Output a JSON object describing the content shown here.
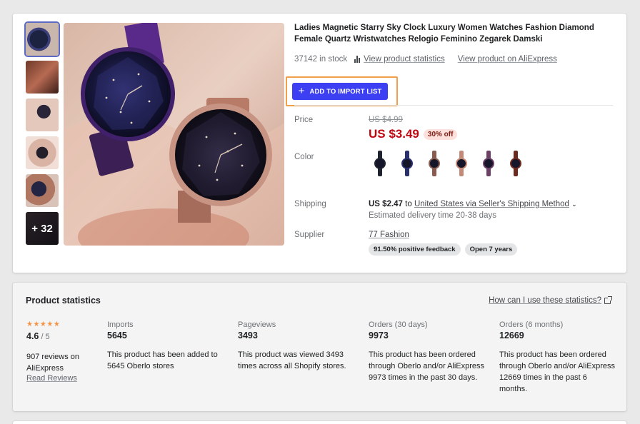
{
  "product": {
    "title": "Ladies Magnetic Starry Sky Clock Luxury Women Watches Fashion Diamond Female Quartz Wristwatches Relogio Feminino Zegarek Damski",
    "stock": "37142 in stock",
    "view_stats_link": "View product statistics",
    "view_aliexpress_link": "View product on AliExpress",
    "add_button": "ADD TO IMPORT LIST",
    "more_images": "+ 32",
    "price_label": "Price",
    "old_price": "US $4.99",
    "price": "US $3.49",
    "discount": "30% off",
    "color_label": "Color",
    "colors": [
      "#1f2330",
      "#2a2f6e",
      "#8a5a4f",
      "#c48a78",
      "#6b3f66",
      "#6b2a1d"
    ],
    "shipping_label": "Shipping",
    "shipping_price": "US $2.47",
    "shipping_to": "to",
    "shipping_method": "United States via Seller's Shipping Method",
    "delivery": "Estimated delivery time 20-38 days",
    "supplier_label": "Supplier",
    "supplier_name": "77 Fashion",
    "feedback": "91.50% positive feedback",
    "open_years": "Open 7 years"
  },
  "stats": {
    "title": "Product statistics",
    "help_link": "How can I use these statistics?",
    "stars": "★★★★★",
    "rating_value": "4.6",
    "rating_max": " / 5",
    "reviews_text": "907 reviews on AliExpress",
    "read_reviews": "Read Reviews",
    "columns": [
      {
        "label": "Imports",
        "value": "5645",
        "desc": "This product has been added to 5645 Oberlo stores"
      },
      {
        "label": "Pageviews",
        "value": "3493",
        "desc": "This product was viewed 3493 times across all Shopify stores."
      },
      {
        "label": "Orders (30 days)",
        "value": "9973",
        "desc": "This product has been ordered through Oberlo and/or AliExpress 9973 times in the past 30 days."
      },
      {
        "label": "Orders (6 months)",
        "value": "12669",
        "desc": "This product has been ordered through Oberlo and/or AliExpress 12669 times in the past 6 months."
      }
    ]
  },
  "colors": {
    "accent": "#3d40f2",
    "highlight": "#f0a04b",
    "price": "#bf0711"
  }
}
